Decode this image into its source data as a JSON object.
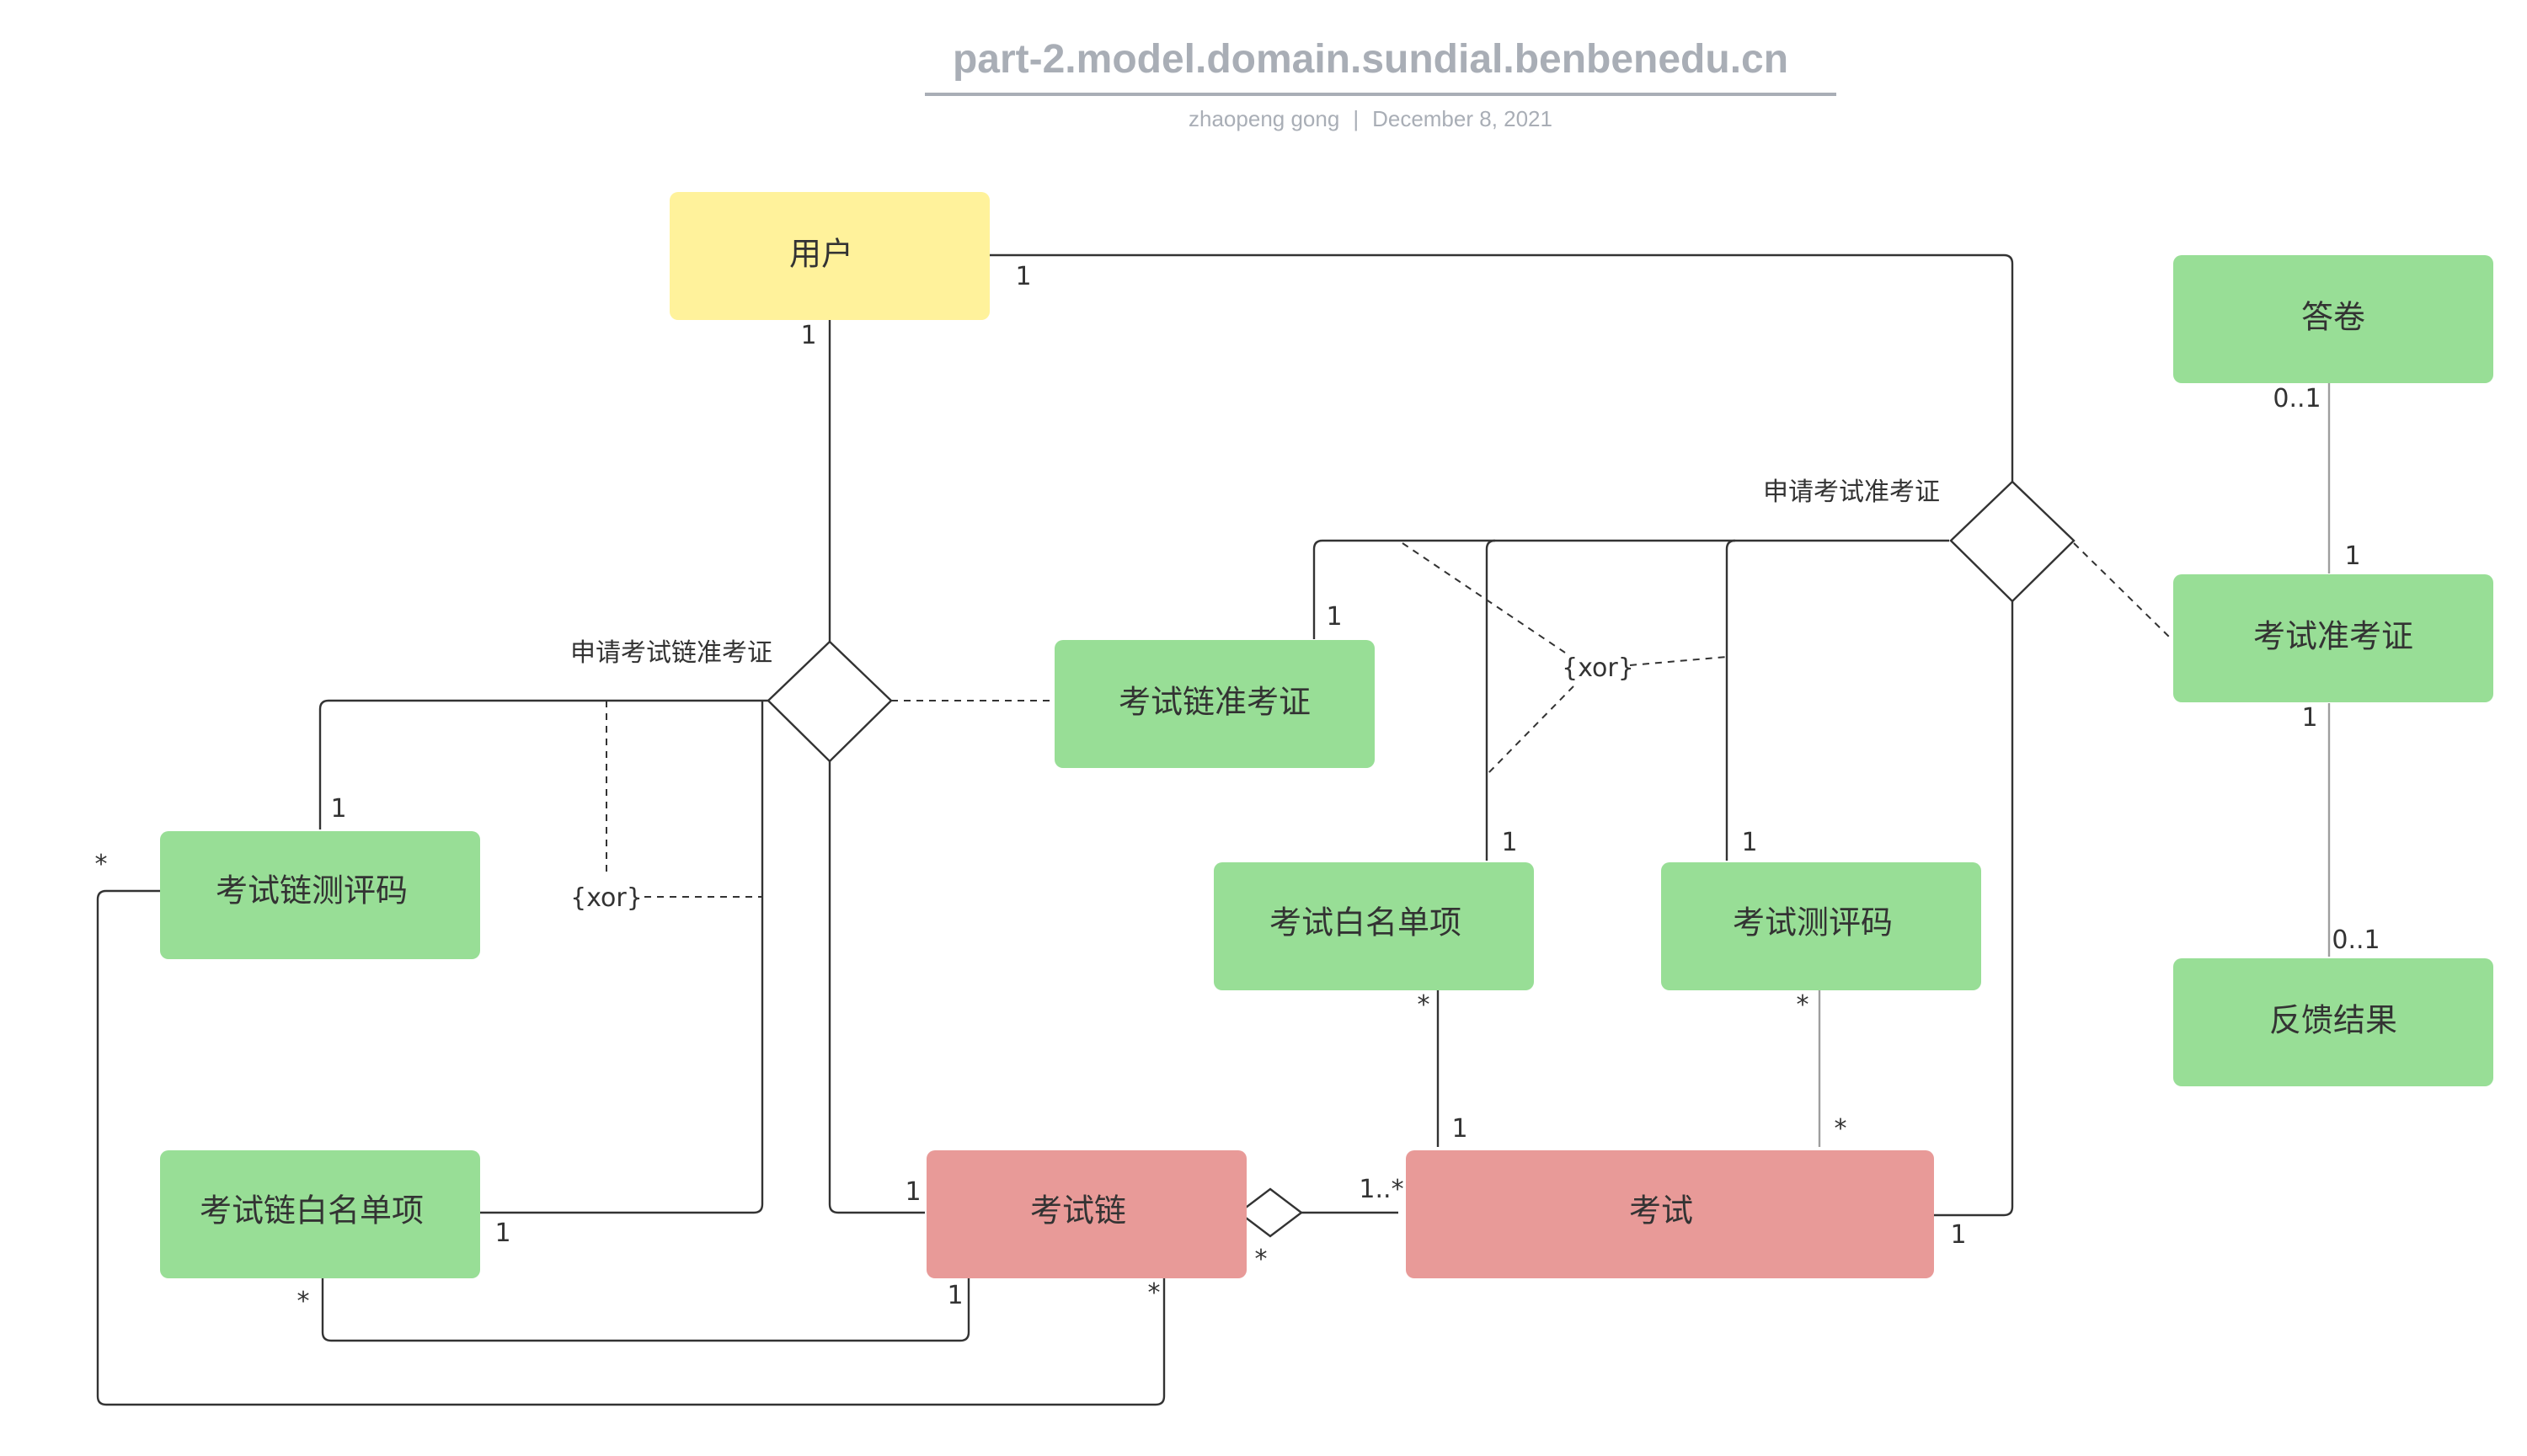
{
  "header": {
    "title": "part-2.model.domain.sundial.benbenedu.cn",
    "author": "zhaopeng gong",
    "separator": "|",
    "date": "December 8, 2021"
  },
  "colors": {
    "yellow": "#fff29b",
    "green": "#98de96",
    "red": "#e89a98",
    "line": "#333333",
    "title": "#a9aeb6"
  },
  "entities": {
    "user": "用户",
    "answer_sheet": "答卷",
    "exam_admission": "考试准考证",
    "feedback": "反馈结果",
    "chain_admission": "考试链准考证",
    "chain_eval_code": "考试链测评码",
    "chain_whitelist": "考试链白名单项",
    "exam_chain": "考试链",
    "exam": "考试",
    "exam_whitelist": "考试白名单项",
    "exam_eval_code": "考试测评码"
  },
  "associations": {
    "apply_chain_admission": "申请考试链准考证",
    "apply_exam_admission": "申请考试准考证"
  },
  "constraints": {
    "xor_left": "{xor}",
    "xor_right": "{xor}"
  },
  "multiplicities": {
    "user_right": "1",
    "user_bottom": "1",
    "answer_sheet": "0..1",
    "admission_top": "1",
    "admission_bottom": "1",
    "feedback": "0..1",
    "chain_admission": "1",
    "chain_eval_code_top": "1",
    "chain_eval_code_left": "*",
    "chain_whitelist_right": "1",
    "chain_whitelist_bottom": "*",
    "chain_left": "1",
    "chain_bottom": "1",
    "chain_bottom_right": "*",
    "chain_diamond": "*",
    "exam_left": "1..*",
    "exam_right": "1",
    "exam_whitelist_top": "1",
    "exam_whitelist_bottom": "*",
    "exam_eval_code_top": "1",
    "exam_eval_code_bottom": "*",
    "exam_top_left": "1",
    "exam_top_right": "*"
  }
}
